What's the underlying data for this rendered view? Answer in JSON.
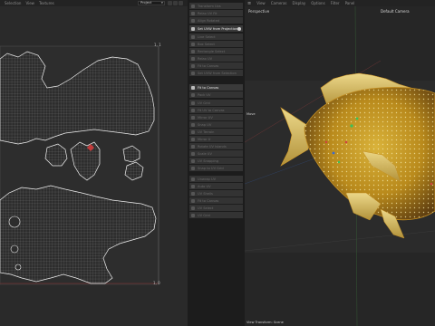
{
  "uv_editor": {
    "menu": [
      "Selection",
      "View",
      "Textures"
    ],
    "project_select": "Project",
    "coord_top_right": "1, 1",
    "coord_bottom_right": "1, 0"
  },
  "middle_panel": {
    "buttons": [
      {
        "label": "Transform Uvs"
      },
      {
        "label": "Relax UV Fit"
      },
      {
        "label": "Align Rotated"
      },
      {
        "label": "Set UVW from Projection"
      },
      {
        "label": "Live Select"
      },
      {
        "label": "Box Select"
      },
      {
        "label": "Rectangle Select"
      },
      {
        "label": "Relax UV"
      },
      {
        "label": "Fit to Canvas"
      },
      {
        "label": "Set UVW from Selection"
      },
      {
        "label": "Pack UV"
      },
      {
        "label": "UV Grid"
      },
      {
        "label": "Fit UV to Canvas"
      },
      {
        "label": "Mirror UV"
      },
      {
        "label": "Snap UV"
      },
      {
        "label": "UV Terrain"
      },
      {
        "label": "Mirror U"
      },
      {
        "label": "Rotate UV Islands"
      },
      {
        "label": "Scale UV"
      },
      {
        "label": "UV Snapping"
      },
      {
        "label": "Snap to UV Grid"
      },
      {
        "label": "Unwrap UV"
      },
      {
        "label": "Auto UV"
      },
      {
        "label": "UV Shells"
      },
      {
        "label": "Fit to Canvas"
      },
      {
        "label": "UV Select"
      }
    ]
  },
  "viewport": {
    "menu": [
      "View",
      "Cameras",
      "Display",
      "Options",
      "Filter",
      "Panel"
    ],
    "camera_label": "Perspective",
    "default_camera": "Default Camera",
    "axis_label": "Move",
    "status_text": "View Transform: Scene"
  },
  "colors": {
    "uv_background": "#2a2a2a",
    "uv_wire": "#e6e6e6",
    "fish_gold": "#c59a24",
    "fish_dark": "#5a3a10",
    "fish_fin": "#e3c877",
    "viewport_bg": "#262626"
  }
}
